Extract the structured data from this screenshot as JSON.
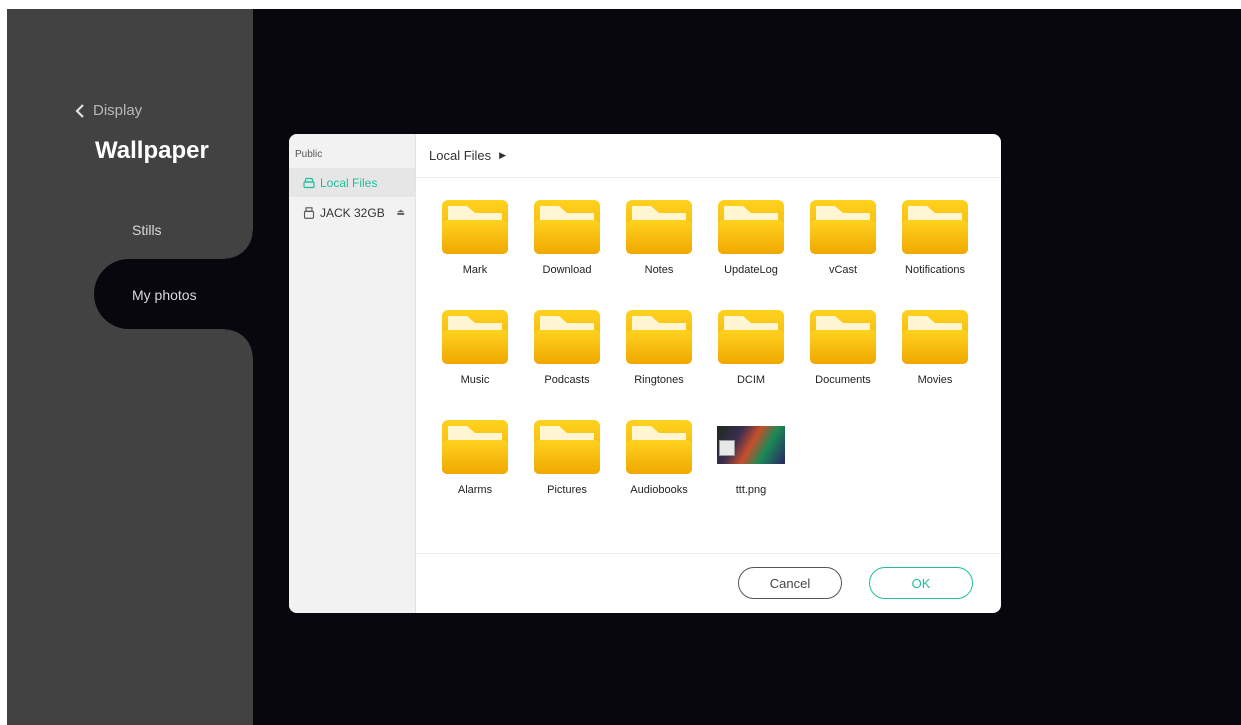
{
  "settings": {
    "back_label": "Display",
    "page_title": "Wallpaper",
    "menu": [
      {
        "label": "Stills",
        "selected": false
      },
      {
        "label": "My photos",
        "selected": true
      }
    ]
  },
  "dialog": {
    "sidebar": {
      "header": "Public",
      "items": [
        {
          "label": "Local Files",
          "icon": "storage-icon",
          "active": true
        },
        {
          "label": "JACK 32GB",
          "icon": "usb-drive-icon",
          "eject_icon": "eject-icon",
          "active": false
        }
      ]
    },
    "breadcrumb": {
      "current": "Local Files",
      "arrow": "▶"
    },
    "files": [
      {
        "name": "Mark",
        "type": "folder"
      },
      {
        "name": "Download",
        "type": "folder"
      },
      {
        "name": "Notes",
        "type": "folder"
      },
      {
        "name": "UpdateLog",
        "type": "folder"
      },
      {
        "name": "vCast",
        "type": "folder"
      },
      {
        "name": "Notifications",
        "type": "folder"
      },
      {
        "name": "Music",
        "type": "folder"
      },
      {
        "name": "Podcasts",
        "type": "folder"
      },
      {
        "name": "Ringtones",
        "type": "folder"
      },
      {
        "name": "DCIM",
        "type": "folder"
      },
      {
        "name": "Documents",
        "type": "folder"
      },
      {
        "name": "Movies",
        "type": "folder"
      },
      {
        "name": "Alarms",
        "type": "folder"
      },
      {
        "name": "Pictures",
        "type": "folder"
      },
      {
        "name": "Audiobooks",
        "type": "folder"
      },
      {
        "name": "ttt.png",
        "type": "image"
      }
    ],
    "buttons": {
      "cancel": "Cancel",
      "ok": "OK"
    }
  },
  "colors": {
    "accent": "#1fbf9c",
    "folder": "#f2b400",
    "background": "#07070d",
    "panel": "#424242"
  }
}
